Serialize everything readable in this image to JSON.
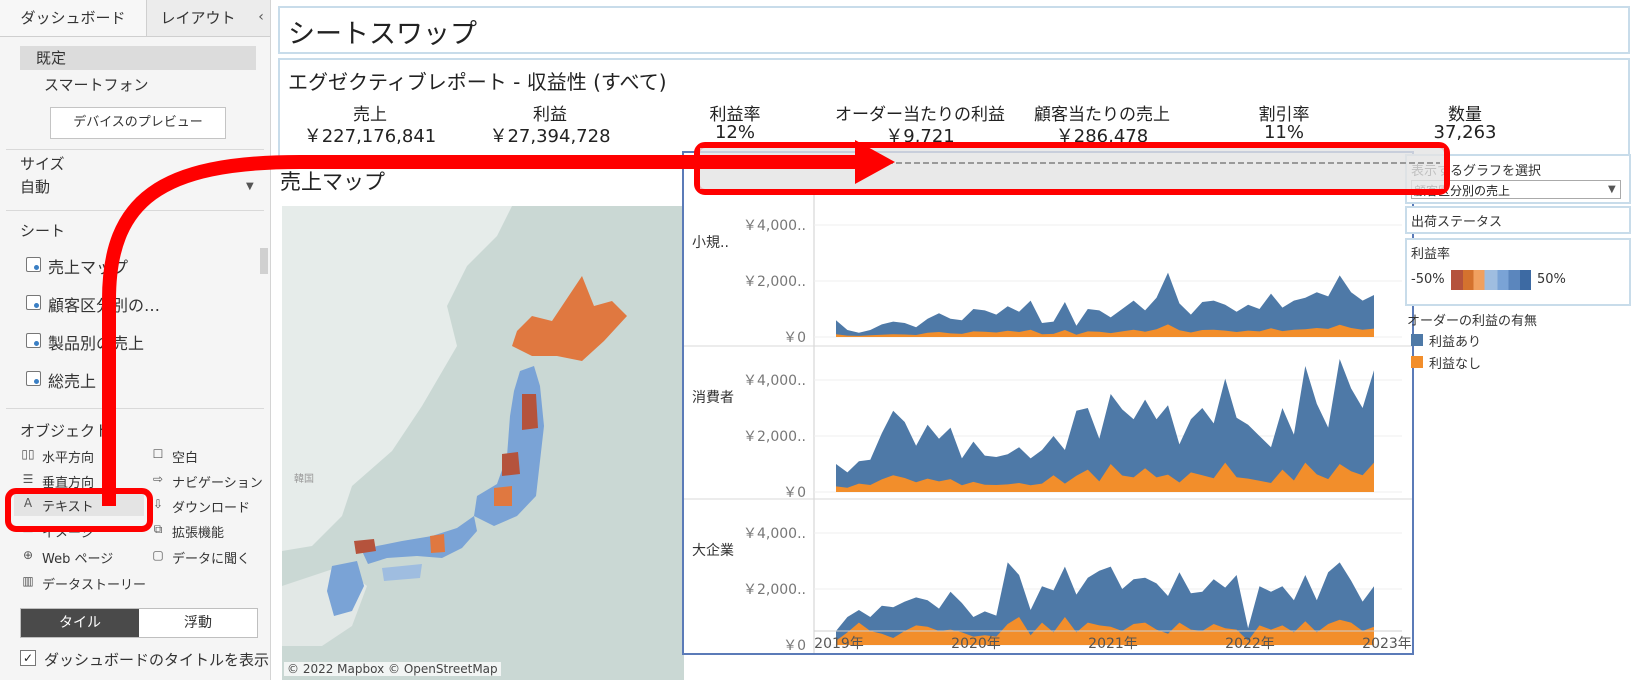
{
  "left_panel": {
    "tabs": [
      "ダッシュボード",
      "レイアウト"
    ],
    "collapse_glyph": "‹",
    "devices": [
      "既定",
      "スマートフォン"
    ],
    "device_preview_button": "デバイスのプレビュー",
    "size": {
      "label": "サイズ",
      "value": "自動"
    },
    "sheets": {
      "label": "シート",
      "items": [
        "売上マップ",
        "顧客区分別の…",
        "製品別の売上",
        "総売上"
      ]
    },
    "objects": {
      "label": "オブジェクト",
      "items": [
        {
          "label": "水平方向",
          "icon": "horizontal-icon"
        },
        {
          "label": "空白",
          "icon": "blank-icon"
        },
        {
          "label": "垂直方向",
          "icon": "vertical-icon"
        },
        {
          "label": "ナビゲーション",
          "icon": "navigation-icon"
        },
        {
          "label": "テキスト",
          "icon": "text-icon"
        },
        {
          "label": "ダウンロード",
          "icon": "download-icon"
        },
        {
          "label": "イメージ",
          "icon": "image-icon"
        },
        {
          "label": "拡張機能",
          "icon": "extension-icon"
        },
        {
          "label": "Web ページ",
          "icon": "globe-icon"
        },
        {
          "label": "データに聞く",
          "icon": "ask-data-icon"
        },
        {
          "label": "データストーリー",
          "icon": "book-icon"
        }
      ]
    },
    "layout_toggle": {
      "tiled": "タイル",
      "floating": "浮動"
    },
    "show_title": {
      "label": "ダッシュボードのタイトルを表示",
      "checked": true
    }
  },
  "dashboard": {
    "title": "シートスワップ",
    "kpi_title": "エグゼクティブレポート - 収益性 (すべて)",
    "kpis": [
      {
        "label": "売上",
        "value": "￥227,176,841"
      },
      {
        "label": "利益",
        "value": "￥27,394,728"
      },
      {
        "label": "利益率",
        "value": "12%"
      },
      {
        "label": "オーダー当たりの利益",
        "value": "￥9,721"
      },
      {
        "label": "顧客当たりの売上",
        "value": "￥286,478"
      },
      {
        "label": "割引率",
        "value": "11%"
      },
      {
        "label": "数量",
        "value": "37,263"
      }
    ],
    "map": {
      "title": "売上マップ",
      "credit": "© 2022 Mapbox © OpenStreetMap",
      "korea_label": "韓国"
    },
    "filters": {
      "graph_select_label": "表示するグラフを選択",
      "graph_select_value": "顧客区分別の売上",
      "ship_status_label": "出荷ステータス",
      "profit_ratio": {
        "label": "利益率",
        "min": "-50%",
        "max": "50%"
      },
      "profit_legend": {
        "label": "オーダーの利益の有無",
        "items": [
          {
            "label": "利益あり",
            "color": "#4e79a7"
          },
          {
            "label": "利益なし",
            "color": "#f28e2b"
          }
        ]
      }
    }
  },
  "colors": {
    "accent_red": "#ff0000",
    "series_blue": "#4e79a7",
    "series_orange": "#f28e2b",
    "map_high": "#e07840",
    "map_low": "#7aa3d6"
  },
  "chart_data": {
    "type": "area",
    "y_tick_labels": [
      "￥4,000..",
      "￥2,000..",
      "￥0"
    ],
    "x_tick_labels": [
      "2019年",
      "2020年",
      "2021年",
      "2022年",
      "2023年"
    ],
    "ylim": [
      0,
      4500
    ],
    "x_count": 48,
    "panels": [
      {
        "name": "小規..",
        "series": [
          {
            "name": "利益あり",
            "values": [
              600,
              250,
              150,
              250,
              450,
              550,
              500,
              350,
              650,
              850,
              650,
              600,
              1000,
              950,
              800,
              1100,
              900,
              1300,
              500,
              550,
              1250,
              400,
              1000,
              950,
              700,
              1000,
              1300,
              950,
              1400,
              2300,
              1200,
              800,
              1250,
              1300,
              1150,
              900,
              1150,
              1000,
              1550,
              1050,
              1300,
              1400,
              1600,
              1450,
              2200,
              1600,
              1300,
              1500
            ]
          },
          {
            "name": "利益なし",
            "values": [
              100,
              50,
              40,
              60,
              80,
              100,
              90,
              70,
              150,
              180,
              130,
              110,
              200,
              190,
              160,
              220,
              180,
              260,
              100,
              110,
              250,
              80,
              200,
              190,
              140,
              200,
              260,
              190,
              280,
              450,
              240,
              160,
              250,
              260,
              230,
              180,
              230,
              200,
              310,
              210,
              260,
              280,
              320,
              290,
              440,
              320,
              260,
              300
            ]
          }
        ]
      },
      {
        "name": "消費者",
        "series": [
          {
            "name": "利益あり",
            "values": [
              1000,
              700,
              1100,
              1150,
              2100,
              2900,
              2500,
              1650,
              2400,
              1900,
              2300,
              1200,
              1800,
              1300,
              1250,
              1350,
              1600,
              1200,
              1500,
              2000,
              1500,
              2900,
              3000,
              1900,
              3500,
              2950,
              2600,
              3300,
              2600,
              3100,
              1700,
              2600,
              3000,
              2450,
              4050,
              2650,
              2400,
              2000,
              1600,
              3000,
              2050,
              4500,
              3150,
              2300,
              4750,
              3700,
              3000,
              4350
            ]
          },
          {
            "name": "利益なし",
            "values": [
              200,
              150,
              300,
              250,
              450,
              600,
              500,
              350,
              480,
              380,
              460,
              240,
              360,
              260,
              250,
              270,
              320,
              240,
              300,
              600,
              300,
              580,
              800,
              380,
              1000,
              590,
              520,
              850,
              520,
              620,
              340,
              700,
              600,
              490,
              1050,
              530,
              480,
              400,
              320,
              800,
              410,
              1050,
              630,
              460,
              1000,
              740,
              600,
              1050
            ]
          }
        ]
      },
      {
        "name": "大企業",
        "series": [
          {
            "name": "利益あり",
            "values": [
              500,
              1000,
              1250,
              1000,
              1400,
              1350,
              1550,
              1700,
              1600,
              1300,
              1900,
              1500,
              1000,
              1200,
              1050,
              2950,
              2500,
              1250,
              2100,
              1950,
              2800,
              1800,
              2400,
              2650,
              2800,
              2000,
              2350,
              2400,
              2200,
              1750,
              2600,
              1850,
              1900,
              2350,
              2050,
              2500,
              600,
              2100,
              1900,
              2100,
              1600,
              2500,
              1600,
              2600,
              2950,
              2300,
              1550,
              2100
            ]
          },
          {
            "name": "利益なし",
            "values": [
              150,
              450,
              800,
              500,
              400,
              250,
              500,
              700,
              650,
              500,
              550,
              450,
              300,
              350,
              300,
              750,
              1000,
              350,
              800,
              450,
              1000,
              450,
              800,
              700,
              650,
              500,
              750,
              800,
              550,
              400,
              800,
              550,
              500,
              750,
              600,
              550,
              150,
              700,
              550,
              700,
              450,
              850,
              450,
              750,
              900,
              800,
              500,
              650
            ]
          }
        ]
      }
    ]
  }
}
